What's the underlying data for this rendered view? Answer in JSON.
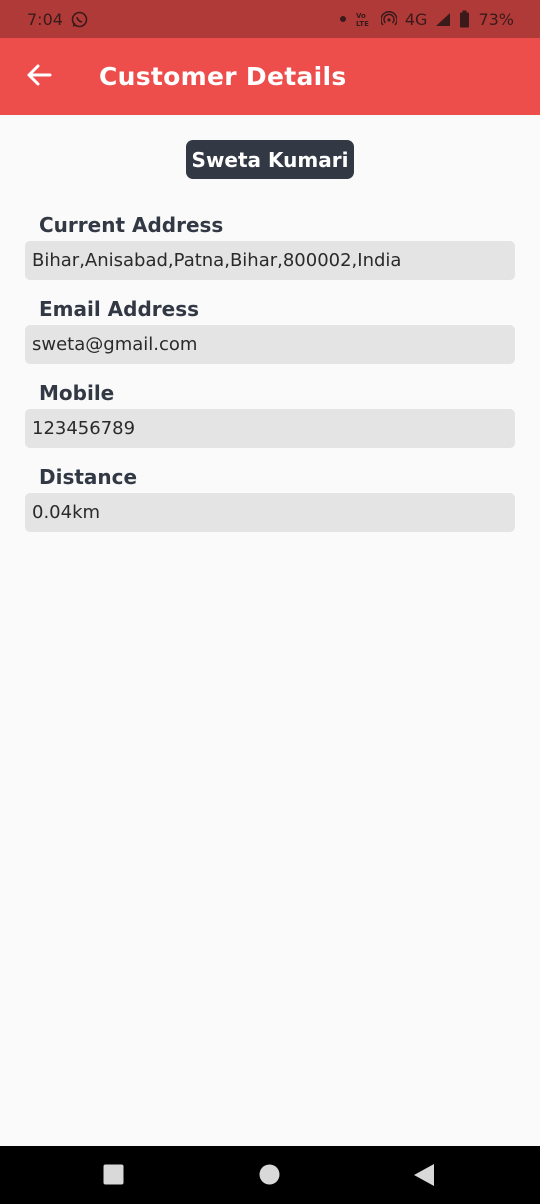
{
  "status_bar": {
    "time": "7:04",
    "network": "4G",
    "battery": "73%",
    "icons": [
      "whatsapp-icon",
      "dot-icon",
      "volte-icon",
      "hotspot-icon",
      "signal-icon",
      "battery-icon"
    ]
  },
  "app_bar": {
    "title": "Customer Details",
    "back_icon": "arrow-left-icon",
    "color": "#ed4e4c"
  },
  "customer": {
    "name": "Sweta Kumari"
  },
  "fields": {
    "address": {
      "label": "Current Address",
      "value": "Bihar,Anisabad,Patna,Bihar,800002,India"
    },
    "email": {
      "label": "Email Address",
      "value": "sweta@gmail.com"
    },
    "mobile": {
      "label": "Mobile",
      "value": "123456789"
    },
    "distance": {
      "label": "Distance",
      "value": "0.04km"
    }
  },
  "nav_bar": {
    "icons": [
      "recents-square-icon",
      "home-circle-icon",
      "back-triangle-icon"
    ]
  }
}
